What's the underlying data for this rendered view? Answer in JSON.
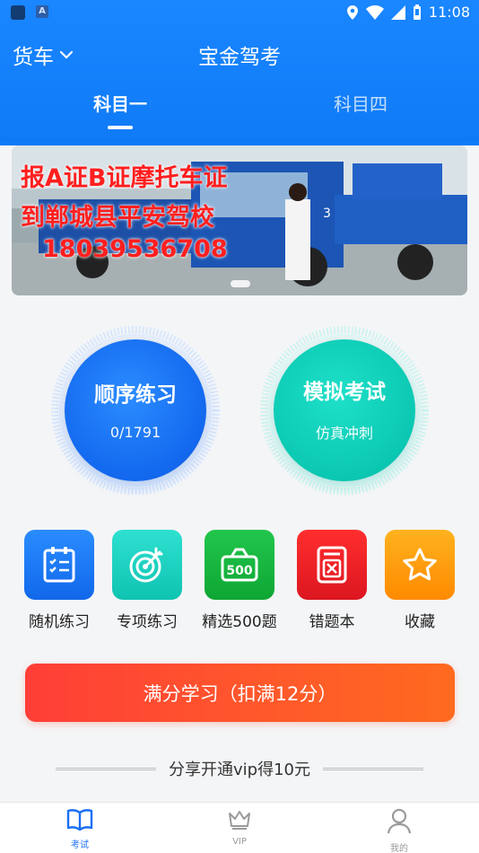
{
  "status_bar": {
    "time": "11:08"
  },
  "header": {
    "vehicle_type": "货车",
    "app_title": "宝金驾考",
    "tabs": [
      "科目一",
      "科目四"
    ]
  },
  "banner": {
    "lines": [
      "报A证B证摩托车证",
      "到郸城县平安驾校",
      "18039536708"
    ]
  },
  "practice": {
    "sequential": {
      "title": "顺序练习",
      "progress": "0/1791"
    },
    "mock_exam": {
      "title": "模拟考试",
      "subtitle": "仿真冲刺"
    }
  },
  "shortcuts": [
    {
      "label": "随机练习",
      "icon": "clipboard-list-icon",
      "color": "#1a7cf5"
    },
    {
      "label": "专项练习",
      "icon": "target-icon",
      "color": "#18c7b6"
    },
    {
      "label": "精选500题",
      "icon": "500-basket-icon",
      "color": "#13b13a"
    },
    {
      "label": "错题本",
      "icon": "wrong-book-icon",
      "color": "#e8202a"
    },
    {
      "label": "收藏",
      "icon": "star-icon",
      "color": "#ff9a00"
    }
  ],
  "full_score_button": "满分学习（扣满12分）",
  "share_text": "分享开通vip得10元",
  "bottom_nav": [
    {
      "label": "考试",
      "icon": "book-icon",
      "active": true
    },
    {
      "label": "VIP",
      "icon": "crown-icon",
      "active": false
    },
    {
      "label": "我的",
      "icon": "person-icon",
      "active": false
    }
  ],
  "colors": {
    "brand_blue": "#1a86ff",
    "active_nav": "#1a6ff5",
    "inactive_nav": "#9a9a9a"
  }
}
